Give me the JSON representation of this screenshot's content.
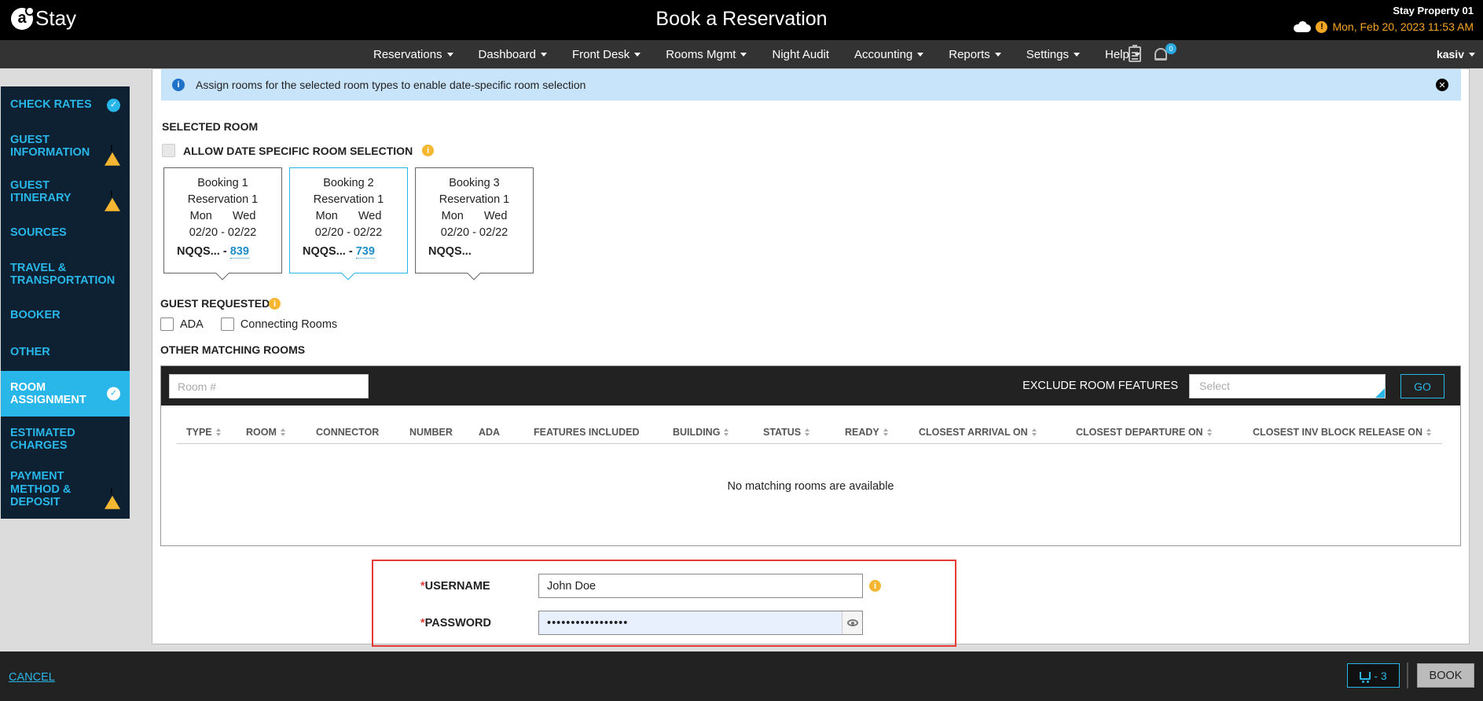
{
  "header": {
    "logo_text": "Stay",
    "title": "Book a Reservation",
    "property": "Stay Property 01",
    "datetime": "Mon, Feb 20, 2023 11:53 AM"
  },
  "nav": {
    "items": [
      "Reservations",
      "Dashboard",
      "Front Desk",
      "Rooms Mgmt",
      "Night Audit",
      "Accounting",
      "Reports",
      "Settings",
      "Help"
    ],
    "notification_count": "0",
    "user": "kasiv"
  },
  "sidebar": {
    "items": [
      {
        "label": "CHECK RATES",
        "status": "check"
      },
      {
        "label": "GUEST INFORMATION",
        "status": "warning"
      },
      {
        "label": "GUEST ITINERARY",
        "status": "warning"
      },
      {
        "label": "SOURCES",
        "status": "none"
      },
      {
        "label": "TRAVEL & TRANSPORTATION",
        "status": "none"
      },
      {
        "label": "BOOKER",
        "status": "none"
      },
      {
        "label": "OTHER",
        "status": "none"
      },
      {
        "label": "ROOM ASSIGNMENT",
        "status": "check"
      },
      {
        "label": "ESTIMATED CHARGES",
        "status": "none"
      },
      {
        "label": "PAYMENT METHOD & DEPOSIT",
        "status": "warning"
      }
    ],
    "active": "ROOM ASSIGNMENT"
  },
  "banner": {
    "text": "Assign rooms for the selected room types to enable date-specific room selection"
  },
  "selected_room": {
    "title": "SELECTED ROOM",
    "allow_label": "ALLOW DATE SPECIFIC ROOM SELECTION",
    "bookings": [
      {
        "booking": "Booking 1",
        "reservation": "Reservation 1",
        "day_from": "Mon",
        "day_to": "Wed",
        "dates": "02/20 - 02/22",
        "room_type": "NQQS...",
        "separator": "-",
        "room": "839"
      },
      {
        "booking": "Booking 2",
        "reservation": "Reservation 1",
        "day_from": "Mon",
        "day_to": "Wed",
        "dates": "02/20 - 02/22",
        "room_type": "NQQS...",
        "separator": "-",
        "room": "739"
      },
      {
        "booking": "Booking 3",
        "reservation": "Reservation 1",
        "day_from": "Mon",
        "day_to": "Wed",
        "dates": "02/20 - 02/22",
        "room_type": "NQQS...",
        "separator": "",
        "room": ""
      }
    ]
  },
  "guest_requested": {
    "title": "GUEST REQUESTED",
    "options": [
      "ADA",
      "Connecting Rooms"
    ]
  },
  "other_rooms": {
    "title": "OTHER MATCHING ROOMS",
    "room_placeholder": "Room #",
    "exclude_label": "EXCLUDE ROOM FEATURES",
    "select_placeholder": "Select",
    "go_label": "GO",
    "columns": [
      "TYPE",
      "ROOM",
      "CONNECTOR",
      "NUMBER",
      "ADA",
      "FEATURES INCLUDED",
      "BUILDING",
      "STATUS",
      "READY",
      "CLOSEST ARRIVAL ON",
      "CLOSEST DEPARTURE ON",
      "CLOSEST INV BLOCK RELEASE ON"
    ],
    "empty_message": "No matching rooms are available"
  },
  "credentials": {
    "required_mark": "*",
    "username_label": "USERNAME",
    "username_value": "John Doe",
    "password_label": "PASSWORD",
    "password_value": "•••••••••••••••••"
  },
  "footer": {
    "cancel_label": "CANCEL",
    "cart_label": "- 3",
    "book_label": "BOOK"
  }
}
